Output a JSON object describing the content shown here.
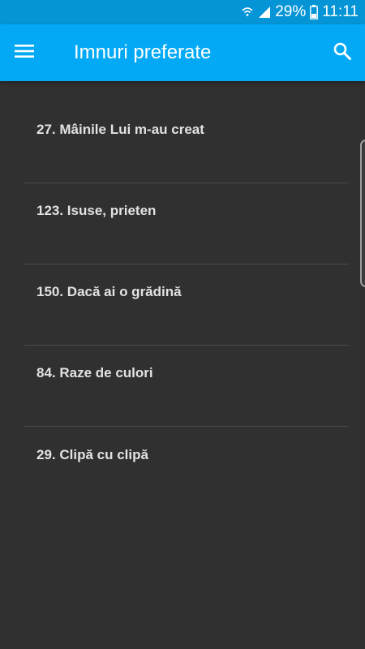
{
  "status_bar": {
    "battery": "29%",
    "time": "11:11"
  },
  "app_bar": {
    "title": "Imnuri preferate",
    "menu_icon": "menu-icon",
    "search_icon": "search-icon"
  },
  "hymns": [
    {
      "label": "27. Mâinile Lui m-au creat"
    },
    {
      "label": "123. Isuse, prieten"
    },
    {
      "label": "150. Dacă ai o grădină"
    },
    {
      "label": "84. Raze de culori"
    },
    {
      "label": "29. Clipă cu clipă"
    }
  ],
  "colors": {
    "status_bar": "#0595d6",
    "app_bar": "#03a9f4",
    "background": "#303030",
    "text": "#e2e2e2"
  }
}
